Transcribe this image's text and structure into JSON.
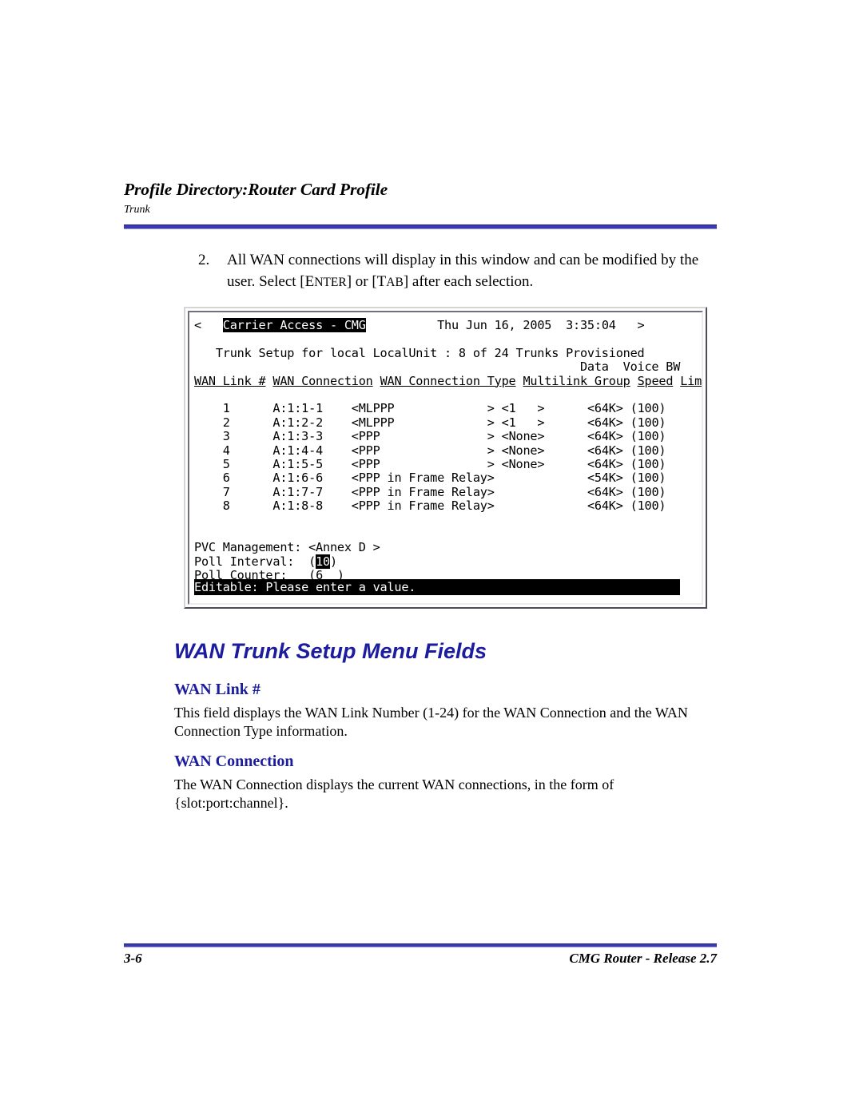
{
  "header": {
    "title": "Profile Directory:Router Card Profile",
    "subtitle": "Trunk"
  },
  "step": {
    "number": "2.",
    "line1_a": "All WAN connections will display in this window and can be modified by the",
    "line2_a": "user. Select [",
    "key1_first": "E",
    "key1_rest": "NTER",
    "line2_b": "] or [",
    "key2_first": "T",
    "key2_rest": "AB",
    "line2_c": "] after each selection."
  },
  "terminal": {
    "left_arrow": "<",
    "right_arrow": ">",
    "app_title": "Carrier Access - CMG",
    "datetime": "Thu Jun 16, 2005  3:35:04",
    "subtitle": "Trunk Setup for local LocalUnit : 8 of 24 Trunks Provisioned",
    "header_line1": "                                                      Data  Voice BW",
    "columns": [
      {
        "label": "WAN Link #",
        "width": 10
      },
      {
        "label": "WAN Connection",
        "width": 14
      },
      {
        "label": "WAN Connection Type",
        "width": 19
      },
      {
        "label": "Multilink Group",
        "width": 15
      },
      {
        "label": "Speed",
        "width": 5
      },
      {
        "label": "Limit %",
        "width": 7
      }
    ],
    "rows": [
      {
        "link": "1",
        "connection": "A:1:1-1",
        "type": "<MLPPP             >",
        "group": "<1   >",
        "speed": "<64K>",
        "bw": "(100)"
      },
      {
        "link": "2",
        "connection": "A:1:2-2",
        "type": "<MLPPP             >",
        "group": "<1   >",
        "speed": "<64K>",
        "bw": "(100)"
      },
      {
        "link": "3",
        "connection": "A:1:3-3",
        "type": "<PPP               >",
        "group": "<None>",
        "speed": "<64K>",
        "bw": "(100)"
      },
      {
        "link": "4",
        "connection": "A:1:4-4",
        "type": "<PPP               >",
        "group": "<None>",
        "speed": "<64K>",
        "bw": "(100)"
      },
      {
        "link": "5",
        "connection": "A:1:5-5",
        "type": "<PPP               >",
        "group": "<None>",
        "speed": "<64K>",
        "bw": "(100)"
      },
      {
        "link": "6",
        "connection": "A:1:6-6",
        "type": "<PPP in Frame Relay>",
        "group": "      ",
        "speed": "<54K>",
        "bw": "(100)"
      },
      {
        "link": "7",
        "connection": "A:1:7-7",
        "type": "<PPP in Frame Relay>",
        "group": "      ",
        "speed": "<64K>",
        "bw": "(100)"
      },
      {
        "link": "8",
        "connection": "A:1:8-8",
        "type": "<PPP in Frame Relay>",
        "group": "      ",
        "speed": "<64K>",
        "bw": "(100)"
      }
    ],
    "pvc": {
      "pvc_label": "PVC Management:",
      "pvc_value": "<Annex D >",
      "poll_interval_label": "Poll Interval:",
      "poll_interval_open": "(",
      "poll_interval_v1": "1",
      "poll_interval_v2": "0",
      "poll_interval_close": ")",
      "poll_counter_label": "Poll Counter:",
      "poll_counter_value": "(6  )"
    },
    "status": "Editable: Please enter a value."
  },
  "sections": {
    "main_title": "WAN Trunk Setup Menu Fields",
    "wan_link": {
      "title": "WAN Link #",
      "body": "This field displays the WAN Link Number (1-24) for the WAN Connection and the WAN Connection Type information."
    },
    "wan_connection": {
      "title": "WAN Connection",
      "body": "The WAN Connection displays the current WAN connections, in the form of {slot:port:channel}."
    }
  },
  "footer": {
    "page_number": "3-6",
    "doc_title": "CMG Router - Release 2.7"
  },
  "colors": {
    "heading_blue": "#1c1c9e",
    "rule_blue": "#3a3ab0",
    "terminal_bg": "#ffffff",
    "terminal_fg": "#000000"
  }
}
